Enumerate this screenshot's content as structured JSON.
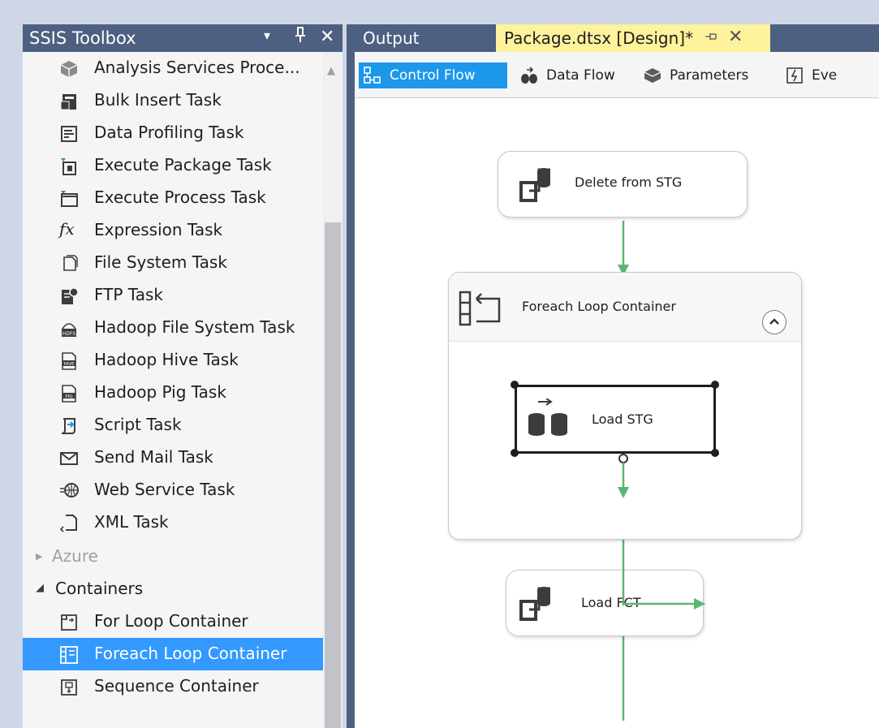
{
  "toolbox": {
    "title": "SSIS Toolbox",
    "header_buttons": [
      "▾",
      "⊥",
      "✕"
    ],
    "items": [
      {
        "label": "Analysis Services Proce...",
        "icon": "cube-icon"
      },
      {
        "label": "Bulk Insert Task",
        "icon": "bulk-insert-icon"
      },
      {
        "label": "Data Profiling Task",
        "icon": "data-profiling-icon"
      },
      {
        "label": "Execute Package Task",
        "icon": "execute-package-icon"
      },
      {
        "label": "Execute Process Task",
        "icon": "execute-process-icon"
      },
      {
        "label": "Expression Task",
        "icon": "fx-icon",
        "glyph": "fx"
      },
      {
        "label": "File System Task",
        "icon": "file-system-icon"
      },
      {
        "label": "FTP Task",
        "icon": "ftp-icon"
      },
      {
        "label": "Hadoop File System Task",
        "icon": "hadoop-hdfs-icon"
      },
      {
        "label": "Hadoop Hive Task",
        "icon": "hadoop-hive-icon"
      },
      {
        "label": "Hadoop Pig Task",
        "icon": "hadoop-pig-icon"
      },
      {
        "label": "Script Task",
        "icon": "script-icon"
      },
      {
        "label": "Send Mail Task",
        "icon": "mail-icon"
      },
      {
        "label": "Web Service Task",
        "icon": "web-service-icon"
      },
      {
        "label": "XML Task",
        "icon": "xml-icon"
      }
    ],
    "groups": [
      {
        "label": "Azure",
        "expanded": false,
        "arrow": "▶"
      },
      {
        "label": "Containers",
        "expanded": true,
        "arrow": "◢"
      }
    ],
    "container_items": [
      {
        "label": "For Loop Container",
        "icon": "for-loop-icon",
        "selected": false
      },
      {
        "label": "Foreach Loop Container",
        "icon": "foreach-loop-icon",
        "selected": true
      },
      {
        "label": "Sequence Container",
        "icon": "sequence-container-icon",
        "selected": false
      }
    ]
  },
  "tabs": {
    "output": "Output",
    "package": "Package.dtsx [Design]*",
    "pin_glyph": "⊣",
    "close_glyph": "✕"
  },
  "designer_toolbar": [
    {
      "label": "Control Flow",
      "active": true,
      "icon": "control-flow-icon"
    },
    {
      "label": "Data Flow",
      "active": false,
      "icon": "data-flow-icon"
    },
    {
      "label": "Parameters",
      "active": false,
      "icon": "parameters-icon"
    },
    {
      "label": "Eve",
      "active": false,
      "icon": "event-handlers-icon"
    }
  ],
  "canvas": {
    "delete_task": "Delete from STG",
    "container": "Foreach Loop Container",
    "load_stg": "Load STG",
    "load_fct": "Load FCT"
  },
  "colors": {
    "header_bg": "#4d6082",
    "active_tab": "#fff29d",
    "selection": "#3399ff",
    "connector": "#5cb474"
  }
}
